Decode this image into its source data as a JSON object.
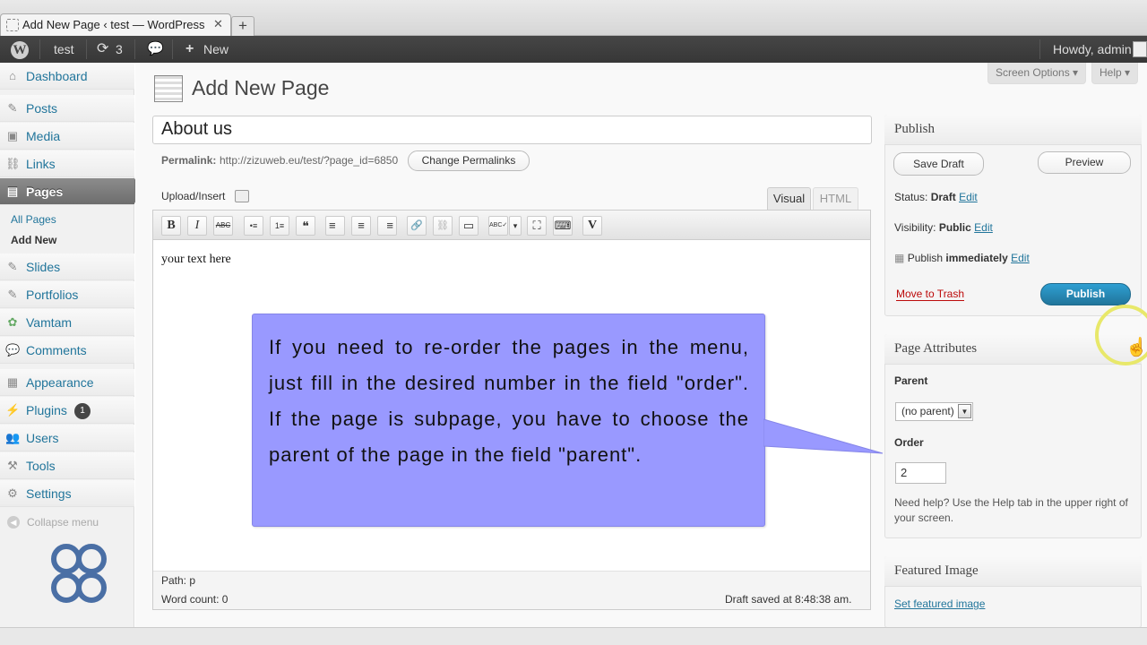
{
  "browser": {
    "tab_title": "Add New Page ‹ test — WordPress",
    "close_glyph": "✕",
    "new_tab_glyph": "+"
  },
  "admin_bar": {
    "site_name": "test",
    "updates_count": "3",
    "new_label": "New",
    "greeting": "Howdy, admin"
  },
  "sidebar": {
    "dashboard": "Dashboard",
    "posts": "Posts",
    "media": "Media",
    "links": "Links",
    "pages": "Pages",
    "pages_sub": [
      "All Pages",
      "Add New"
    ],
    "slides": "Slides",
    "portfolios": "Portfolios",
    "vamtam": "Vamtam",
    "comments": "Comments",
    "appearance": "Appearance",
    "plugins": "Plugins",
    "plugins_badge": "1",
    "users": "Users",
    "tools": "Tools",
    "settings": "Settings",
    "collapse": "Collapse menu"
  },
  "screen_options": "Screen Options ▾",
  "help": "Help ▾",
  "page_title": "Add New Page",
  "post_title": "About us",
  "permalink": {
    "label": "Permalink:",
    "url": "http://zizuweb.eu/test/?page_id=6850",
    "button": "Change Permalinks"
  },
  "editor": {
    "upload_label": "Upload/Insert",
    "tab_visual": "Visual",
    "tab_html": "HTML",
    "toolbar": [
      "B",
      "I",
      "ABC",
      "•≡",
      "1≡",
      "❝",
      "≡",
      "≡",
      "≡",
      "🔗",
      "⛓",
      "▭",
      "ABC✓",
      "▾",
      "⛶",
      "⌨",
      "V"
    ],
    "content": "your text here",
    "path": "Path: p",
    "word_count": "Word count: 0",
    "draft_saved": "Draft saved at 8:48:38 am."
  },
  "callout_text": "If you need to re-order the pages in the menu, just fill in the desired number in the field \"order\". If the page is subpage, you have to choose the parent of the page in the field \"parent\".",
  "publish_box": {
    "title": "Publish",
    "save_draft": "Save Draft",
    "preview": "Preview",
    "status_label": "Status:",
    "status_value": "Draft",
    "visibility_label": "Visibility:",
    "visibility_value": "Public",
    "publish_label": "Publish",
    "publish_value": "immediately",
    "edit": "Edit",
    "move_to_trash": "Move to Trash",
    "publish_button": "Publish"
  },
  "page_attributes": {
    "title": "Page Attributes",
    "parent_label": "Parent",
    "parent_value": "(no parent)",
    "order_label": "Order",
    "order_value": "2",
    "help_text": "Need help? Use the Help tab in the upper right of your screen."
  },
  "featured_image": {
    "title": "Featured Image",
    "link": "Set featured image"
  },
  "colors": {
    "link": "#21759b",
    "callout_bg": "#9999ff",
    "publish_button": "#21759b",
    "trash": "#bc0b0b",
    "admin_bar": "#464646"
  }
}
